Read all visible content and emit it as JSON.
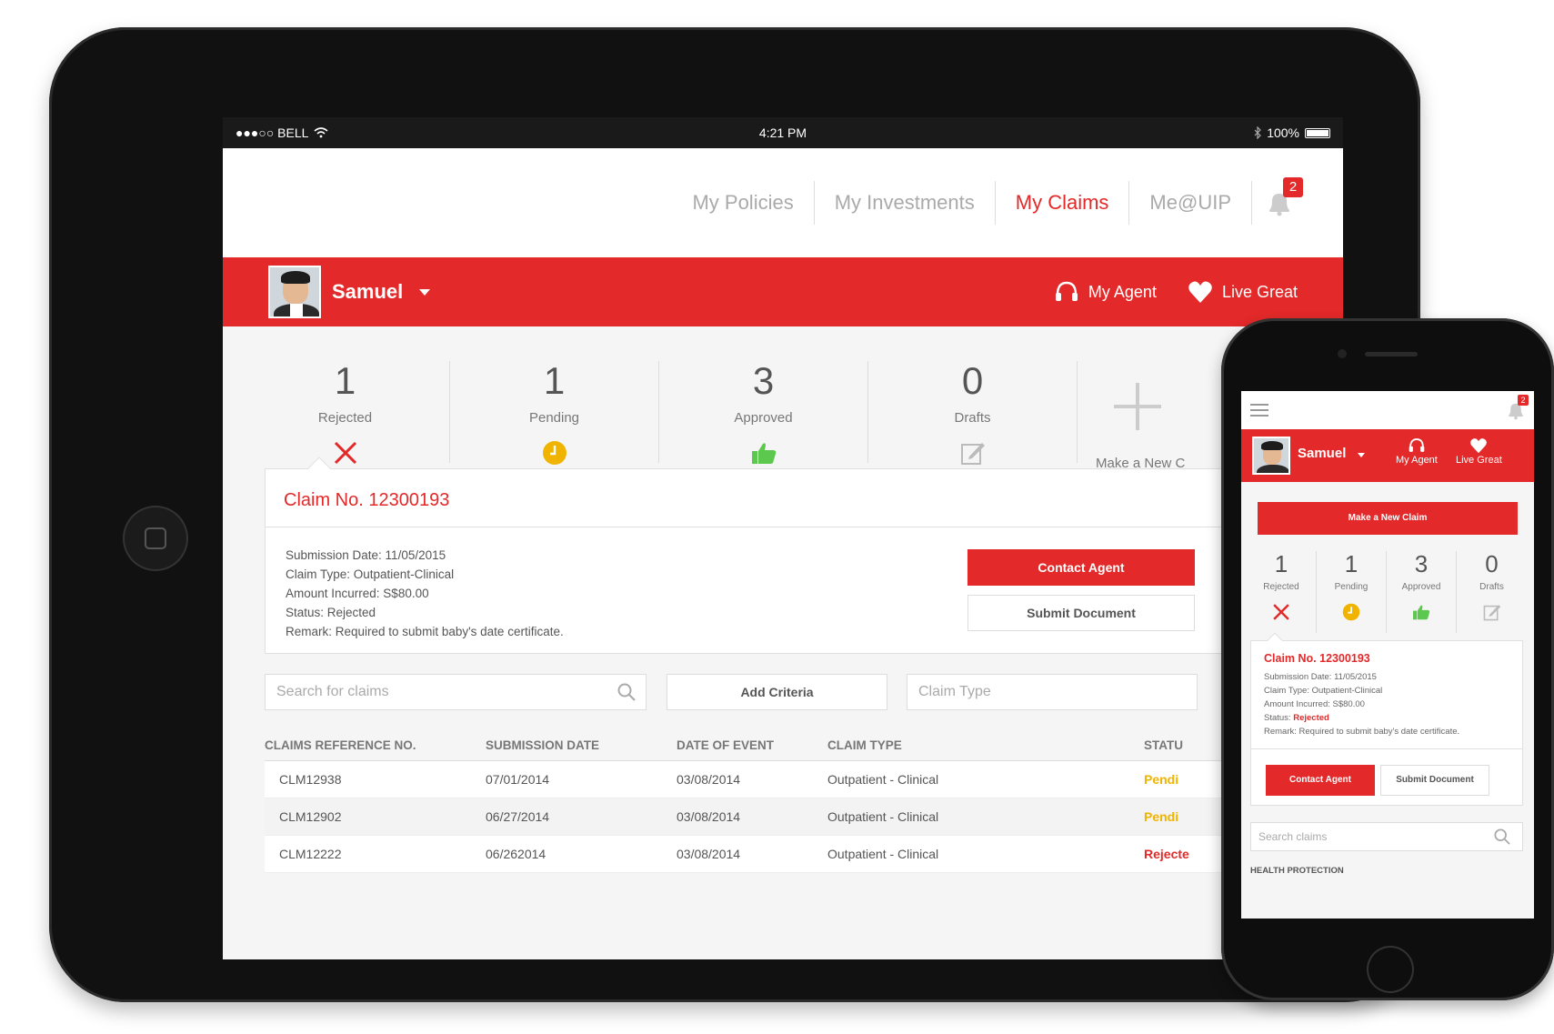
{
  "tablet": {
    "status_bar": {
      "carrier": "●●●○○ BELL",
      "time": "4:21 PM",
      "battery": "100%"
    },
    "nav": {
      "items": [
        {
          "label": "My Policies",
          "active": false
        },
        {
          "label": "My Investments",
          "active": false
        },
        {
          "label": "My Claims",
          "active": true
        },
        {
          "label": "Me@UIP",
          "active": false
        }
      ],
      "notification_count": "2"
    },
    "header": {
      "user_name": "Samuel",
      "my_agent": "My Agent",
      "live_great": "Live Great"
    },
    "stats": [
      {
        "count": "1",
        "label": "Rejected",
        "icon": "x-icon"
      },
      {
        "count": "1",
        "label": "Pending",
        "icon": "clock-icon"
      },
      {
        "count": "3",
        "label": "Approved",
        "icon": "thumbs-up-icon"
      },
      {
        "count": "0",
        "label": "Drafts",
        "icon": "edit-icon"
      }
    ],
    "new_claim_label": "Make a New C",
    "claim": {
      "title": "Claim No. 12300193",
      "submission_date": "Submission Date: 11/05/2015",
      "claim_type": "Claim Type: Outpatient-Clinical",
      "amount": "Amount Incurred: S$80.00",
      "status": "Status: Rejected",
      "remark": "Remark: Required to submit baby's date certificate.",
      "contact_agent": "Contact Agent",
      "submit_document": "Submit Document"
    },
    "search": {
      "placeholder": "Search for claims",
      "add_criteria": "Add Criteria",
      "claim_type_placeholder": "Claim Type"
    },
    "table": {
      "headers": [
        "CLAIMS REFERENCE NO.",
        "SUBMISSION DATE",
        "DATE OF EVENT",
        "CLAIM TYPE",
        "STATU"
      ],
      "rows": [
        {
          "ref": "CLM12938",
          "submitted": "07/01/2014",
          "event": "03/08/2014",
          "type": "Outpatient - Clinical",
          "status": "Pendi"
        },
        {
          "ref": "CLM12902",
          "submitted": "06/27/2014",
          "event": "03/08/2014",
          "type": "Outpatient - Clinical",
          "status": "Pendi"
        },
        {
          "ref": "CLM12222",
          "submitted": "06/262014",
          "event": "03/08/2014",
          "type": "Outpatient - Clinical",
          "status": "Rejecte"
        }
      ]
    }
  },
  "phone": {
    "notification_count": "2",
    "user_name": "Samuel",
    "my_agent": "My Agent",
    "live_great": "Live Great",
    "new_claim_button": "Make a New Claim",
    "stats": [
      {
        "count": "1",
        "label": "Rejected"
      },
      {
        "count": "1",
        "label": "Pending"
      },
      {
        "count": "3",
        "label": "Approved"
      },
      {
        "count": "0",
        "label": "Drafts"
      }
    ],
    "claim": {
      "title": "Claim No. 12300193",
      "submission_date": "Submission Date: 11/05/2015",
      "claim_type": "Claim Type: Outpatient-Clinical",
      "amount": "Amount Incurred: S$80.00",
      "status_label": "Status: ",
      "status_value": "Rejected",
      "remark": "Remark: Required to submit baby's date certificate.",
      "contact_agent": "Contact Agent",
      "submit_document": "Submit Document"
    },
    "search_placeholder": "Search claims",
    "section_label": "HEALTH PROTECTION"
  },
  "colors": {
    "brand_red": "#e32929",
    "pending_yellow": "#f0b400",
    "approved_green": "#5cc94e"
  }
}
